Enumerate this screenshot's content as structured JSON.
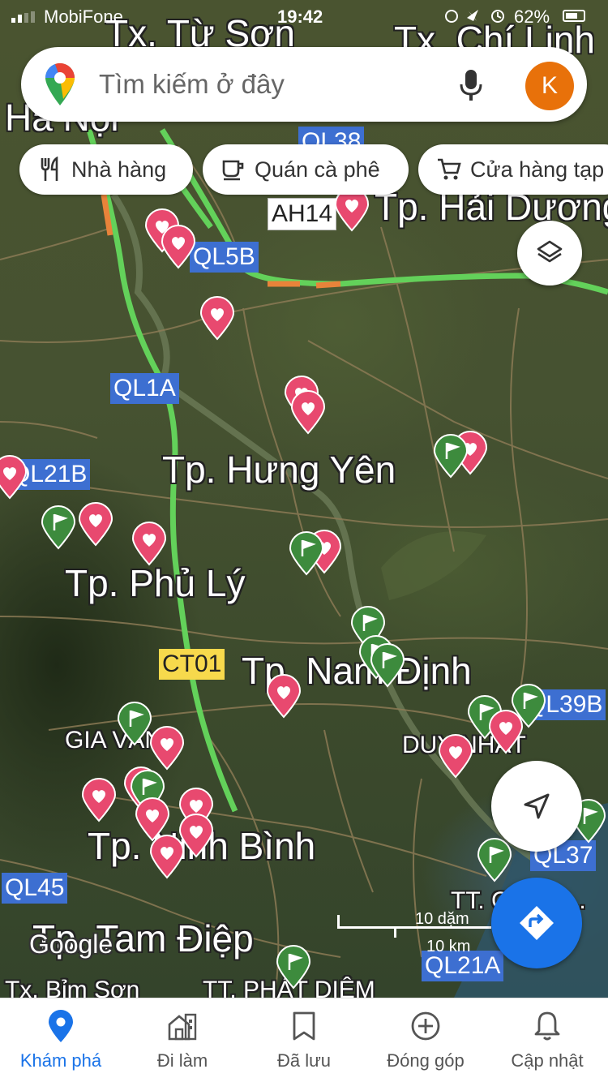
{
  "status_bar": {
    "carrier": "MobiFone",
    "time": "19:42",
    "battery": "62%"
  },
  "search": {
    "placeholder": "Tìm kiếm ở đây",
    "avatar_letter": "K"
  },
  "chips": [
    {
      "label": "Nhà hàng",
      "icon": "restaurant-icon"
    },
    {
      "label": "Quán cà phê",
      "icon": "coffee-icon"
    },
    {
      "label": "Cửa hàng tạp",
      "icon": "cart-icon"
    }
  ],
  "map": {
    "cities": {
      "tu_son": "Tx. Từ Sơn",
      "chi_linh": "Tx. Chí Linh",
      "ha_noi": "Hà Nội",
      "hai_duong": "Tp. Hải Dương",
      "hung_yen": "Tp. Hưng Yên",
      "phu_ly": "Tp. Phủ Lý",
      "nam_dinh": "Tp. Nam Định",
      "gia_van": "GIA VÂN",
      "duy_nhat": "DUY NHẤT",
      "ninh_binh": "Tp. Ninh Bình",
      "tam_diep": "Tp. Tam Điệp",
      "bim_son": "Tx. Bỉm Sơn",
      "phat_diem": "TT. PHÁT DIỆM",
      "tt_la": "TT. C... LÂ..."
    },
    "roads": {
      "ql38": "QL38",
      "ah14": "AH14",
      "ql5b": "QL5B",
      "ql1a": "QL1A",
      "ql21b": "QL21B",
      "ct01": "CT01",
      "ql39b": "QL39B",
      "ql37": "QL37",
      "ql45": "QL45",
      "ql21a": "QL21A"
    },
    "scale": {
      "miles": "10 dặm",
      "km": "10 km"
    },
    "attribution": "Google",
    "colors": {
      "saved_pin": "#e8496f",
      "flag_pin": "#3d8b3d",
      "traffic_green": "#63d15a",
      "traffic_orange": "#e8833a",
      "route_shield": "#3d6fd1",
      "accent": "#1a73e8"
    }
  },
  "bottom_nav": [
    {
      "label": "Khám phá",
      "icon": "explore-pin-icon",
      "active": true
    },
    {
      "label": "Đi làm",
      "icon": "commute-icon",
      "active": false
    },
    {
      "label": "Đã lưu",
      "icon": "bookmark-icon",
      "active": false
    },
    {
      "label": "Đóng góp",
      "icon": "add-circle-icon",
      "active": false
    },
    {
      "label": "Cập nhật",
      "icon": "bell-icon",
      "active": false
    }
  ]
}
